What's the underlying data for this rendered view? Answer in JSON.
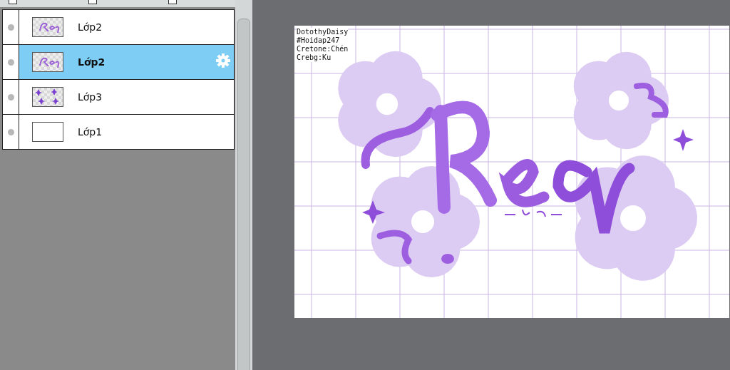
{
  "top_checkboxes": [
    {
      "checked": false
    },
    {
      "checked": false
    },
    {
      "checked": false
    }
  ],
  "layers": [
    {
      "name": "Lớp2",
      "selected": false,
      "kind": "lettering"
    },
    {
      "name": "Lớp2",
      "selected": true,
      "kind": "lettering"
    },
    {
      "name": "Lớp3",
      "selected": false,
      "kind": "sparkles"
    },
    {
      "name": "Lớp1",
      "selected": false,
      "kind": "blank"
    }
  ],
  "canvas": {
    "credits": [
      "DotothyDaisy",
      "#Hoidap247",
      "Cretone:Chén",
      "Crebg:Ku"
    ]
  }
}
